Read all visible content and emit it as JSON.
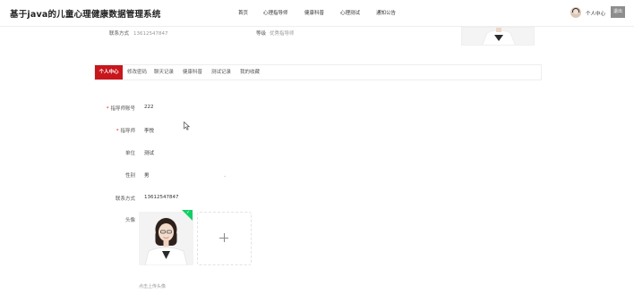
{
  "header": {
    "site_title": "基于java的儿童心理健康数据管理系统",
    "nav": [
      "首页",
      "心理指导师",
      "健康科普",
      "心理测试",
      "通知公告"
    ],
    "user_center": "个人中心",
    "logout": "退出"
  },
  "profile_summary": {
    "contact_label": "联系方式",
    "contact_value": "13612547847",
    "level_label": "等级",
    "level_value": "优秀指导师"
  },
  "tabs": [
    "个人中心",
    "修改密码",
    "聊天记录",
    "健康科普",
    "测试记录",
    "我的收藏"
  ],
  "active_tab": "个人中心",
  "form": {
    "account_label": "指导师账号",
    "account_value": "222",
    "name_label": "指导师",
    "name_value": "李悦",
    "unit_label": "单位",
    "unit_value": "测试",
    "gender_label": "性别",
    "gender_value": "男",
    "contact_label": "联系方式",
    "contact_value": "13612547847",
    "avatar_label": "头像",
    "upload_hint": "点击上传头像"
  },
  "icons": {
    "plus": "plus-icon",
    "check": "check-icon",
    "select_arrow": "chevron-down-icon",
    "cursor": "mouse-pointer-icon"
  },
  "colors": {
    "accent": "#c8161d",
    "success": "#13ce66",
    "logout_bg": "#8d8d8d"
  }
}
